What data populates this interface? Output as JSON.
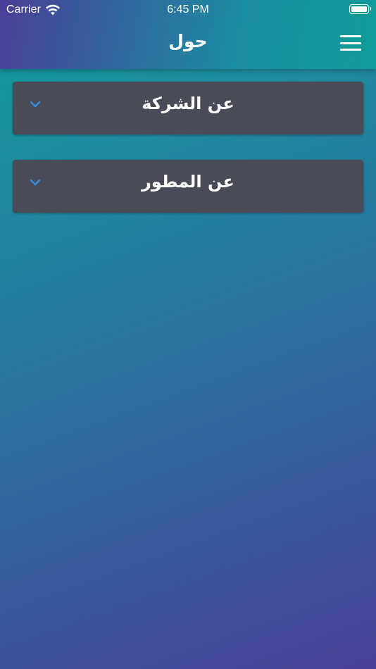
{
  "status_bar": {
    "carrier": "Carrier",
    "time": "6:45 PM",
    "wifi_icon": "wifi-icon",
    "battery_icon": "battery-icon"
  },
  "header": {
    "title": "حول",
    "menu_icon": "hamburger-menu-icon"
  },
  "sections": [
    {
      "title": "عن الشركة",
      "icon": "chevron-down-icon"
    },
    {
      "title": "عن المطور",
      "icon": "chevron-down-icon"
    }
  ],
  "colors": {
    "card_background": "#4a4b58",
    "chevron": "#2f8fe0",
    "gradient_start": "#0f9c9b",
    "gradient_end": "#4a3f97"
  }
}
